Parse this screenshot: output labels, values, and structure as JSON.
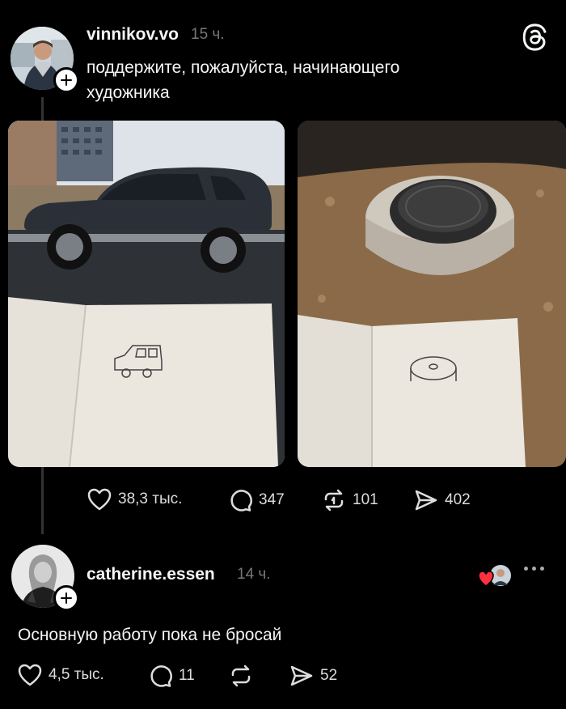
{
  "post": {
    "username": "vinnikov.vo",
    "time": "15 ч.",
    "text_line1": "поддержите, пожалуйста, начинающего",
    "text_line2": "художника",
    "likes": "38,3 тыс.",
    "comments": "347",
    "reposts": "101",
    "shares": "402"
  },
  "reply": {
    "username": "catherine.essen",
    "time": "14 ч.",
    "text": "Основную работу пока не бросай",
    "likes": "4,5 тыс.",
    "comments": "11",
    "shares": "52"
  },
  "colors": {
    "background": "#000000",
    "text": "#f3f5f7",
    "muted": "#777777",
    "heart": "#ff3040"
  },
  "icons": [
    "threads-logo-icon",
    "heart-icon",
    "comment-icon",
    "repost-icon",
    "share-icon",
    "more-icon",
    "plus-icon"
  ]
}
